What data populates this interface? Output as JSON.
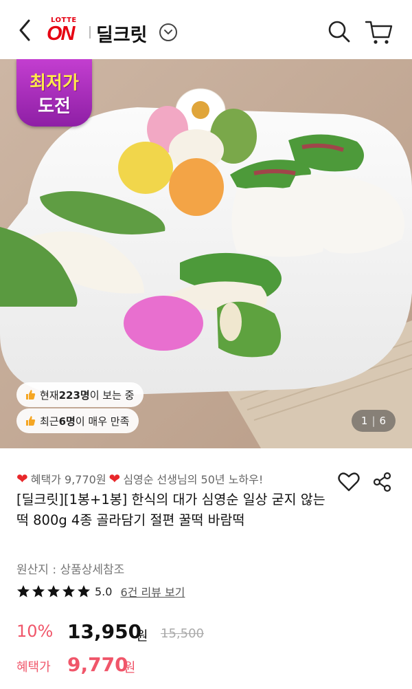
{
  "header": {
    "logo_top": "LOTTE",
    "logo_main": "ON",
    "store_name": "딜크릿"
  },
  "hero": {
    "badge": {
      "line1": "최저가",
      "line2": "도전"
    },
    "viewers": {
      "prefix": "현재 ",
      "count": "223명",
      "suffix": "이 보는 중"
    },
    "satisfied": {
      "prefix": "최근 ",
      "count": "6명",
      "suffix": "이 매우 만족"
    },
    "counter": {
      "current": "1",
      "total": "6"
    }
  },
  "product": {
    "promo_part1": "혜택가 9,770원",
    "promo_part2": "심영순 선생님의 50년 노하우!",
    "title": "[딜크릿][1봉+1봉] 한식의 대가 심영순 일상 굳지 않는 떡 800g 4종 골라담기 절편 꿀떡 바람떡",
    "origin": "원산지 : 상품상세참조",
    "rating": {
      "stars": 5,
      "score": "5.0",
      "review_link": "6건 리뷰 보기"
    },
    "price": {
      "discount": "10%",
      "sale_price": "13,950",
      "unit": "원",
      "original_price": "15,500",
      "benefit_label": "혜택가",
      "benefit_price": "9,770",
      "benefit_unit": "원"
    }
  },
  "colors": {
    "brand_red": "#e60012",
    "accent_pink": "#f0566a",
    "badge_purple": "#a22bb9"
  }
}
